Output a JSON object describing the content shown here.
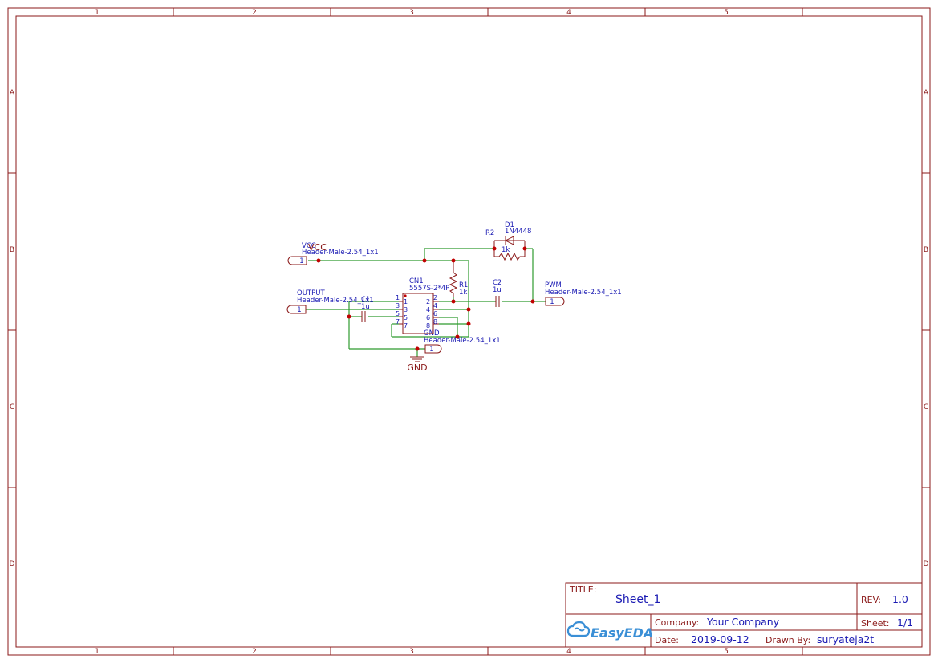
{
  "frame": {
    "columns": [
      "1",
      "2",
      "3",
      "4",
      "5"
    ],
    "rows": [
      "A",
      "B",
      "C",
      "D"
    ]
  },
  "components": {
    "vcc_header": {
      "net": "VCC",
      "part": "Header-Male-2.54_1x1",
      "pin": "1",
      "power": "VCC"
    },
    "output_header": {
      "net": "OUTPUT",
      "part": "Header-Male-2.54_1x1",
      "pin": "1"
    },
    "pwm_header": {
      "net": "PWM",
      "part": "Header-Male-2.54_1x1",
      "pin": "1"
    },
    "gnd_header": {
      "net": "GND",
      "part": "Header-Male-2.54_1x1",
      "pin": "1",
      "power": "GND"
    },
    "cn1": {
      "ref": "CN1",
      "part": "5557S-2*4P",
      "left_pins": [
        "1",
        "3",
        "5",
        "7"
      ],
      "right_pins": [
        "2",
        "4",
        "6",
        "8"
      ],
      "inner_left": [
        "1",
        "3",
        "5",
        "7"
      ],
      "inner_right": [
        "2",
        "4",
        "6",
        "8"
      ]
    },
    "r1": {
      "ref": "R1",
      "value": "1k"
    },
    "r2": {
      "ref": "R2",
      "value": "1k"
    },
    "d1": {
      "ref": "D1",
      "value": "1N4448"
    },
    "c1": {
      "ref": "C1",
      "value": "1u"
    },
    "c2": {
      "ref": "C2",
      "value": "1u"
    }
  },
  "title_block": {
    "title_label": "TITLE:",
    "title_value": "Sheet_1",
    "rev_label": "REV:",
    "rev_value": "1.0",
    "logo_text": "EasyEDA",
    "company_label": "Company:",
    "company_value": "Your Company",
    "sheet_label": "Sheet:",
    "sheet_value": "1/1",
    "date_label": "Date:",
    "date_value": "2019-09-12",
    "drawn_label": "Drawn By:",
    "drawn_value": "suryateja2t"
  },
  "colors": {
    "frame": "#8b1a1a",
    "wire": "#2e9b2e",
    "text": "#1a1ab3",
    "junction": "#c00000"
  }
}
